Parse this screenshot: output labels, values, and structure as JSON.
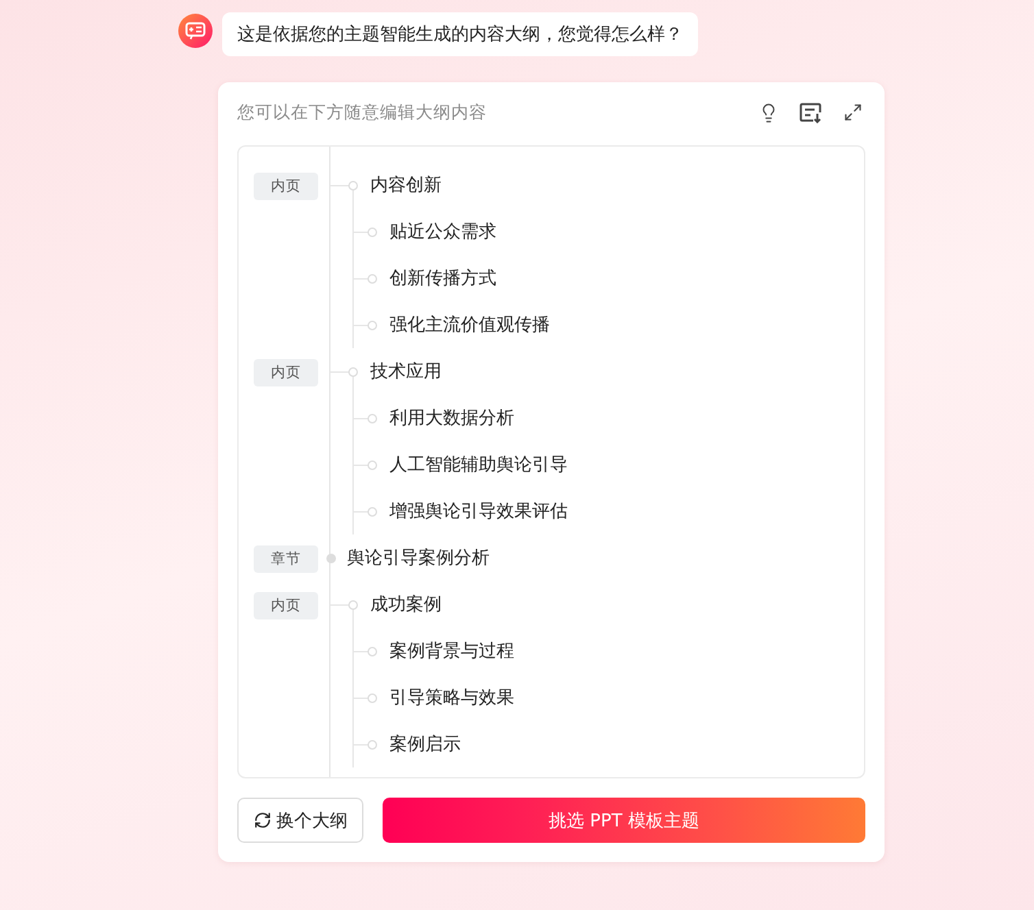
{
  "message": {
    "text": "这是依据您的主题智能生成的内容大纲，您觉得怎么样？"
  },
  "panel": {
    "hint": "您可以在下方随意编辑大纲内容",
    "outline": [
      {
        "kind": "page",
        "tag": "内页",
        "text": "内容创新"
      },
      {
        "kind": "point",
        "text": "贴近公众需求"
      },
      {
        "kind": "point",
        "text": "创新传播方式"
      },
      {
        "kind": "point",
        "text": "强化主流价值观传播"
      },
      {
        "kind": "page",
        "tag": "内页",
        "text": "技术应用"
      },
      {
        "kind": "point",
        "text": "利用大数据分析"
      },
      {
        "kind": "point",
        "text": "人工智能辅助舆论引导"
      },
      {
        "kind": "point",
        "text": "增强舆论引导效果评估"
      },
      {
        "kind": "chapter",
        "tag": "章节",
        "text": "舆论引导案例分析"
      },
      {
        "kind": "page",
        "tag": "内页",
        "text": "成功案例"
      },
      {
        "kind": "point",
        "text": "案例背景与过程"
      },
      {
        "kind": "point",
        "text": "引导策略与效果"
      },
      {
        "kind": "point",
        "text": "案例启示"
      }
    ],
    "buttons": {
      "secondary": "换个大纲",
      "primary": "挑选 PPT 模板主题"
    }
  }
}
